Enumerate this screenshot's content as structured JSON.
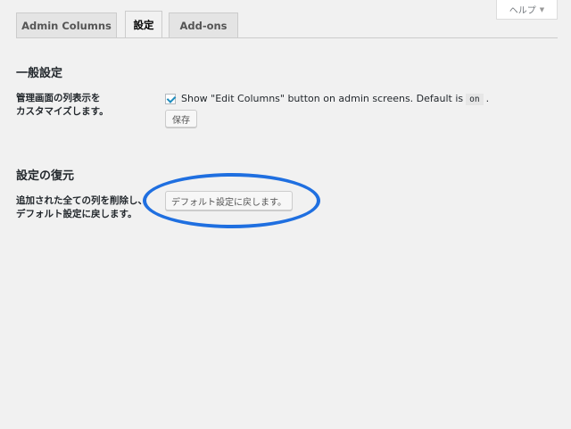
{
  "help_tab": {
    "label": "ヘルプ",
    "arrow": "▼"
  },
  "tabs": [
    {
      "label": "Admin Columns"
    },
    {
      "label": "設定"
    },
    {
      "label": "Add-ons"
    }
  ],
  "general": {
    "title": "一般設定",
    "description_line1": "管理画面の列表示を",
    "description_line2": "カスタマイズします。",
    "checkbox_label_before": "Show \"Edit Columns\" button on admin screens. Default is",
    "checkbox_code": "on",
    "checkbox_label_after": ".",
    "checkbox_checked": true,
    "save_label": "保存"
  },
  "restore": {
    "title": "設定の復元",
    "description_line1": "追加された全ての列を削除し、",
    "description_line2": "デフォルト設定に戻します。",
    "restore_button_label": "デフォルト設定に戻します。"
  },
  "colors": {
    "background": "#f1f1f1",
    "checkmark": "#1e8cbe",
    "highlight_ring": "#1f6fe0"
  }
}
